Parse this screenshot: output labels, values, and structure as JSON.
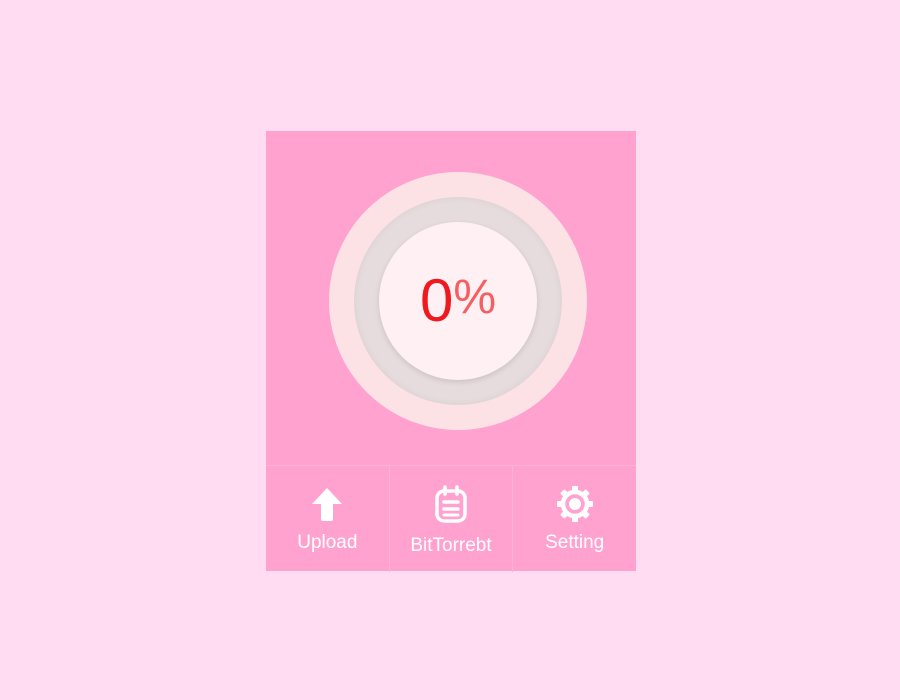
{
  "colors": {
    "page_background": "#ffdcf1",
    "panel_background": "#ffa2d0",
    "dial_outer": "#fde2e5",
    "dial_track": "#e6dcde",
    "dial_center": "#fff0f4",
    "percent_value": "#ef1a1f",
    "percent_unit": "#f46062",
    "toolbar_text": "#ffffff"
  },
  "progress": {
    "value": "0",
    "unit": "%"
  },
  "toolbar": {
    "items": [
      {
        "label": "Upload",
        "icon": "upload-arrow-icon"
      },
      {
        "label": "BitTorrebt",
        "icon": "notepad-icon"
      },
      {
        "label": "Setting",
        "icon": "gear-icon"
      }
    ]
  }
}
